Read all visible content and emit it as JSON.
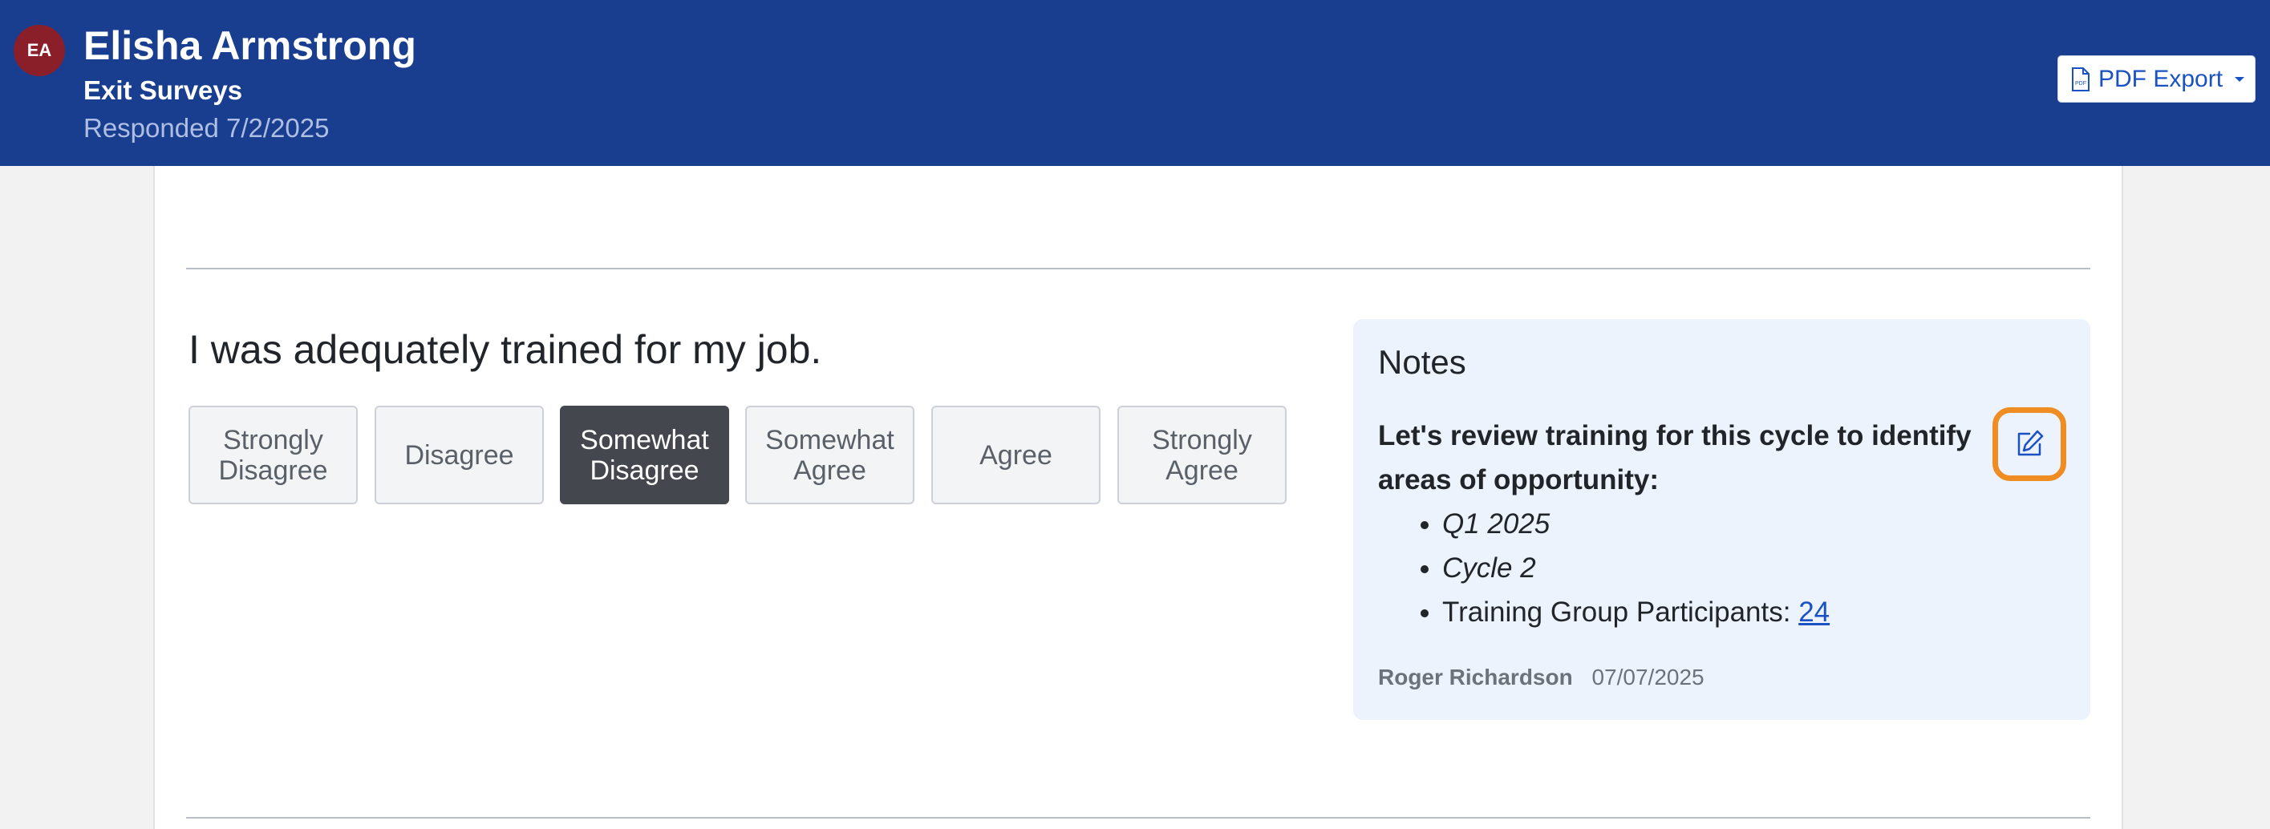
{
  "header": {
    "avatar_initials": "EA",
    "name": "Elisha Armstrong",
    "survey": "Exit Surveys",
    "responded": "Responded 7/2/2025",
    "pdf_export_label": "PDF Export",
    "colors": {
      "bar": "#1a3e8f",
      "avatar": "#8a1f2a"
    }
  },
  "question": {
    "text": "I was adequately trained for my job.",
    "choices": [
      {
        "line1": "Strongly",
        "line2": "Disagree",
        "selected": false
      },
      {
        "line1": "Disagree",
        "line2": "",
        "selected": false
      },
      {
        "line1": "Somewhat",
        "line2": "Disagree",
        "selected": true
      },
      {
        "line1": "Somewhat",
        "line2": "Agree",
        "selected": false
      },
      {
        "line1": "Agree",
        "line2": "",
        "selected": false
      },
      {
        "line1": "Strongly",
        "line2": "Agree",
        "selected": false
      }
    ]
  },
  "notes": {
    "title": "Notes",
    "lead": "Let's review training for this cycle to identify areas of opportunity:",
    "bullets": {
      "b1": "Q1 2025",
      "b2": "Cycle 2",
      "b3_prefix": "Training Group Participants: ",
      "b3_link": "24"
    },
    "author": "Roger Richardson",
    "date": "07/07/2025",
    "edit_icon": "edit-icon",
    "highlight_color": "#ef8c22"
  }
}
